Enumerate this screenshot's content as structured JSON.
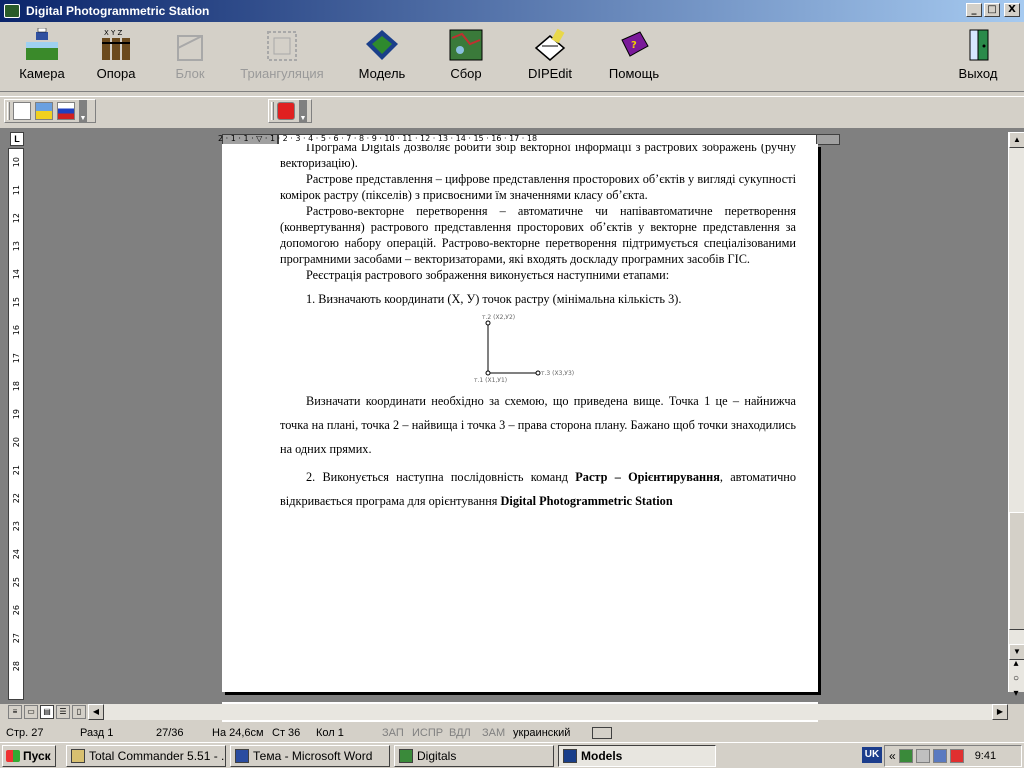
{
  "window": {
    "title": "Digital Photogrammetric Station",
    "buttons": {
      "minimize": "_",
      "maximize": "□",
      "close": "X"
    }
  },
  "toolbar": {
    "items": [
      {
        "label": "Камера",
        "icon": "camera-icon",
        "enabled": true
      },
      {
        "label": "Опора",
        "icon": "control-points-icon",
        "enabled": true
      },
      {
        "label": "Блок",
        "icon": "block-icon",
        "enabled": false
      },
      {
        "label": "Триангуляция",
        "icon": "triangulation-icon",
        "enabled": false
      },
      {
        "label": "Модель",
        "icon": "model-icon",
        "enabled": true
      },
      {
        "label": "Сбор",
        "icon": "collect-icon",
        "enabled": true
      },
      {
        "label": "DIPEdit",
        "icon": "dipedit-icon",
        "enabled": true
      },
      {
        "label": "Помощь",
        "icon": "help-book-icon",
        "enabled": true
      },
      {
        "label": "Выход",
        "icon": "exit-door-icon",
        "enabled": true
      }
    ],
    "xyz_label": "X Y Z"
  },
  "ruler": {
    "tab_selector": "L",
    "h_ticks": "2 · 1 · 1 · ▽ · 1 · 2 · 3 · 4 · 5 · 6 · 7 · 8 · 9 · 10 · 11 · 12 · 13 · 14 · 15 · 16 · 17 · 18",
    "v_ticks": [
      "10",
      "11",
      "12",
      "13",
      "14",
      "15",
      "16",
      "17",
      "18",
      "19",
      "20",
      "21",
      "22",
      "23",
      "24",
      "25",
      "26",
      "27",
      "28"
    ]
  },
  "document": {
    "cut_line": "Програма Digitals дозволяє робити збір векторної інформації з растрових",
    "p0_end": "зображень (ручну векторизацію).",
    "p1": "Растрове представлення – цифрове представлення просторових об’єктів у вигляді сукупності комірок растру (пікселів) з присвоєними їм значеннями класу об’єкта.",
    "p2": "Растрово-векторне перетворення – автоматичне чи напівавтоматичне перетворення (конвертування) растрового представлення просторових об’єктів у векторне представлення за допомогою набору операцій. Растрово-векторне перетворення підтримується спеціалізованими програмними засобами – векторизаторами, які входять доскладу програмних засобів ГІС.",
    "p3": "Реєстрація растрового зображення виконується наступними етапами:",
    "item1": "1. Визначають координати (X, У) точок растру (мінімальна кількість 3).",
    "diagram": {
      "point2": "т.2 (X2,У2)",
      "point1": "т.1 (X1,У1)",
      "point3": "т.3 (X3,У3)"
    },
    "p4": "Визначати координати необхідно за схемою, що приведена вище. Точка 1 це – найнижча точка на плані, точка 2 – найвища і точка 3 – права сторона плану. Бажано щоб точки знаходились на одних прямих.",
    "item2_pre": "2. Виконується наступна послідовність команд ",
    "item2_bold1": "Растр – Орієнтирування",
    "item2_mid": ", автоматично відкривається програма для орієнтування ",
    "item2_bold2": "Digital Photogrammetric Station"
  },
  "statusbar": {
    "page": "Стр.  27",
    "section": "Разд  1",
    "pages": "27/36",
    "position": "На  24,6см",
    "line": "Ст  36",
    "column": "Кол  1",
    "rec": "ЗАП",
    "trk": "ИСПР",
    "ext": "ВДЛ",
    "ovr": "ЗАМ",
    "language": "украинский"
  },
  "taskbar": {
    "start": "Пуск",
    "tasks": [
      {
        "label": "Total Commander 5.51 - ...",
        "icon": "total-commander-icon",
        "active": false
      },
      {
        "label": "Тема - Microsoft Word",
        "icon": "word-icon",
        "active": false
      },
      {
        "label": "Digitals",
        "icon": "digitals-icon",
        "active": false
      },
      {
        "label": "Models",
        "icon": "models-icon",
        "active": true
      }
    ],
    "lang": "UK",
    "clock": "9:41"
  },
  "colors": {
    "titlebar_start": "#0a246a",
    "titlebar_end": "#a6caf0",
    "face": "#d4d0c8",
    "workspace": "#808080"
  }
}
